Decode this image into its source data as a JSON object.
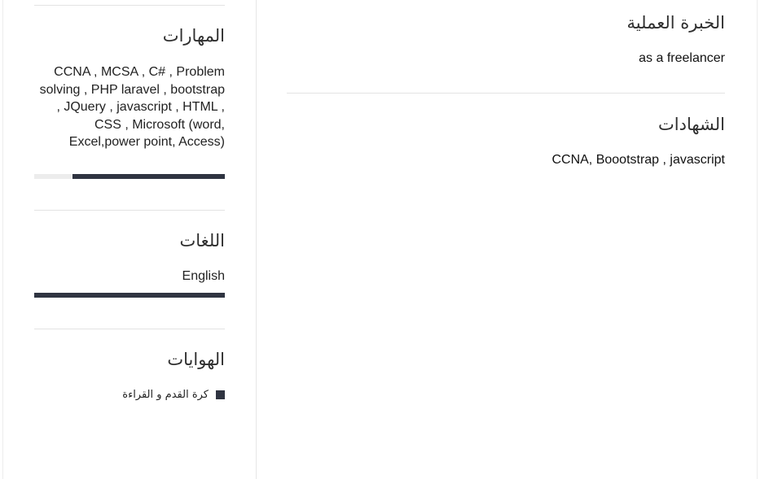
{
  "sidebar": {
    "skills": {
      "title": "المهارات",
      "text": "CCNA ,  MCSA , C# , Problem solving , PHP laravel , bootstrap ,  JQuery , javascript , HTML , CSS , Microsoft (word, Excel,power point, Access)",
      "level": 0.8
    },
    "languages": {
      "title": "اللغات",
      "items": [
        {
          "name": "English",
          "level": 1.0
        }
      ]
    },
    "hobbies": {
      "title": "الهوايات",
      "items": [
        {
          "label": "كرة القدم و القراءة"
        }
      ]
    }
  },
  "main": {
    "experience": {
      "title": "الخبرة العملية",
      "text": "as a freelancer"
    },
    "certificates": {
      "title": "الشهادات",
      "text": "CCNA, Boootstrap , javascript"
    }
  },
  "colors": {
    "bar_fill": "#2f3441",
    "bar_track": "#ececec",
    "divider": "#e3e3e3"
  }
}
